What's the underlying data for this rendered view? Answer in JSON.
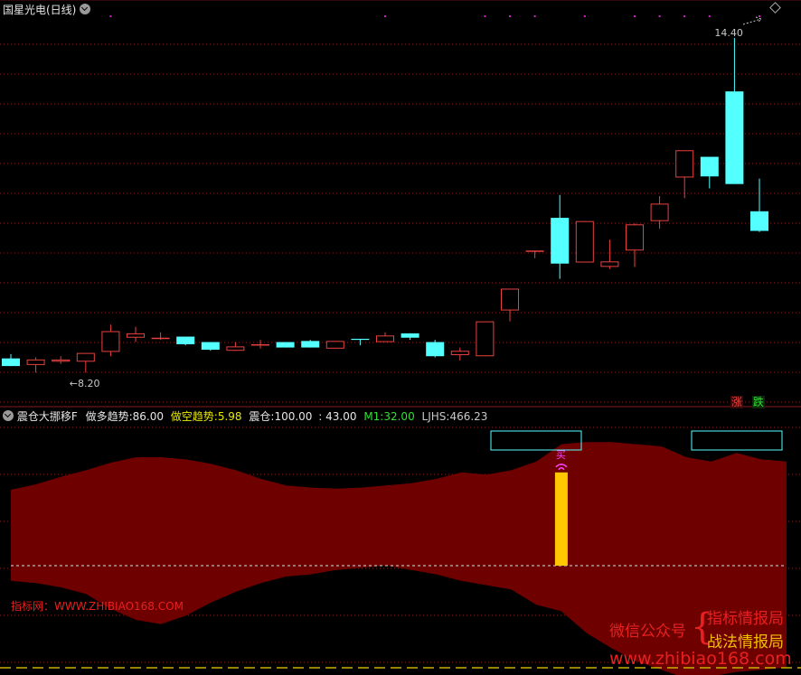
{
  "header": {
    "stock_title": "国星光电(日线)"
  },
  "indicator": {
    "name": "震仓大挪移F",
    "long_label": "做多趋势:",
    "long_value": "86.00",
    "short_label": "做空趋势:",
    "short_value": "5.98",
    "shake_label": "震仓:",
    "shake_value": "100.00",
    "extra_value": ": 43.00",
    "m1_label": "M1:",
    "m1_value": "32.00",
    "ljhs_label": "LJHS:",
    "ljhs_value": "466.23",
    "buy_label": "买",
    "left_watermark": "指标网：WWW.ZHIBIAO168.COM"
  },
  "legend": {
    "up": "涨",
    "down": "跌"
  },
  "watermark": {
    "wechat_label": "微信公众号",
    "line1": "指标情报局",
    "line2": "战法情报局",
    "url": "www.zhibiao168.com"
  },
  "colors": {
    "up": "#e84040",
    "down": "#54ffff",
    "band": "#6e0000",
    "grid": "#8a1a1a",
    "magenta": "#d020d0",
    "yellow": "#e8e800",
    "green": "#30e030",
    "bar_yellow": "#ffc800",
    "bar_red": "#ff0000"
  },
  "chart_data": [
    {
      "type": "candlestick",
      "title": "国星光电(日线)",
      "y_range": [
        8.0,
        14.6
      ],
      "annotations": [
        {
          "text": "14.40",
          "value": 14.4,
          "index": 29
        },
        {
          "text": "←8.20",
          "value": 8.2,
          "index": 3
        }
      ],
      "series": [
        {
          "open": 8.52,
          "high": 8.6,
          "low": 8.38,
          "close": 8.38
        },
        {
          "open": 8.4,
          "high": 8.54,
          "low": 8.26,
          "close": 8.5
        },
        {
          "open": 8.46,
          "high": 8.56,
          "low": 8.42,
          "close": 8.5
        },
        {
          "open": 8.46,
          "high": 8.62,
          "low": 8.26,
          "close": 8.62
        },
        {
          "open": 8.64,
          "high": 9.14,
          "low": 8.56,
          "close": 9.02
        },
        {
          "open": 8.9,
          "high": 9.1,
          "low": 8.82,
          "close": 8.98
        },
        {
          "open": 8.88,
          "high": 9.0,
          "low": 8.86,
          "close": 8.9
        },
        {
          "open": 8.92,
          "high": 8.92,
          "low": 8.76,
          "close": 8.78
        },
        {
          "open": 8.82,
          "high": 8.82,
          "low": 8.66,
          "close": 8.68
        },
        {
          "open": 8.66,
          "high": 8.82,
          "low": 8.66,
          "close": 8.74
        },
        {
          "open": 8.76,
          "high": 8.86,
          "low": 8.7,
          "close": 8.78
        },
        {
          "open": 8.82,
          "high": 8.82,
          "low": 8.72,
          "close": 8.72
        },
        {
          "open": 8.84,
          "high": 8.86,
          "low": 8.72,
          "close": 8.72
        },
        {
          "open": 8.7,
          "high": 8.84,
          "low": 8.7,
          "close": 8.84
        },
        {
          "open": 8.88,
          "high": 8.88,
          "low": 8.76,
          "close": 8.86
        },
        {
          "open": 8.82,
          "high": 9.0,
          "low": 8.82,
          "close": 8.94
        },
        {
          "open": 8.98,
          "high": 8.98,
          "low": 8.86,
          "close": 8.9
        },
        {
          "open": 8.82,
          "high": 8.86,
          "low": 8.54,
          "close": 8.56
        },
        {
          "open": 8.58,
          "high": 8.72,
          "low": 8.48,
          "close": 8.66
        },
        {
          "open": 8.56,
          "high": 9.2,
          "low": 8.56,
          "close": 9.2
        },
        {
          "open": 9.4,
          "high": 9.8,
          "low": 9.2,
          "close": 9.8
        },
        {
          "open": 10.5,
          "high": 10.5,
          "low": 10.36,
          "close": 10.5
        },
        {
          "open": 11.1,
          "high": 11.52,
          "low": 9.98,
          "close": 10.26
        },
        {
          "open": 10.28,
          "high": 11.04,
          "low": 10.28,
          "close": 11.04
        },
        {
          "open": 10.2,
          "high": 10.7,
          "low": 10.16,
          "close": 10.3
        },
        {
          "open": 10.5,
          "high": 11.0,
          "low": 10.2,
          "close": 10.98
        },
        {
          "open": 11.04,
          "high": 11.5,
          "low": 10.9,
          "close": 11.36
        },
        {
          "open": 11.84,
          "high": 12.2,
          "low": 11.46,
          "close": 12.34
        },
        {
          "open": 12.22,
          "high": 12.22,
          "low": 11.64,
          "close": 11.86
        },
        {
          "open": 13.42,
          "high": 14.4,
          "low": 11.72,
          "close": 11.72
        },
        {
          "open": 11.22,
          "high": 11.82,
          "low": 10.84,
          "close": 10.86
        }
      ]
    },
    {
      "type": "area",
      "title": "震仓大挪移F",
      "y_range": [
        0,
        100
      ],
      "band_upper": [
        70,
        75,
        82,
        88,
        95,
        100,
        100,
        98,
        94,
        88,
        80,
        74,
        72,
        71,
        72,
        74,
        76,
        80,
        86,
        84,
        88,
        96,
        112,
        114,
        114,
        112,
        110,
        100,
        96,
        104,
        98,
        96
      ],
      "band_lower": [
        -14,
        -16,
        -20,
        -26,
        -40,
        -50,
        -54,
        -46,
        -34,
        -24,
        -16,
        -10,
        -8,
        -4,
        -2,
        0,
        -4,
        -8,
        -14,
        -18,
        -22,
        -36,
        -42,
        -62,
        -76,
        -88,
        -96,
        -104,
        -102,
        -98,
        -96,
        -94
      ],
      "signal_index": 22,
      "signal_bar": {
        "yellow": 86.0,
        "red": 100.0
      }
    }
  ]
}
